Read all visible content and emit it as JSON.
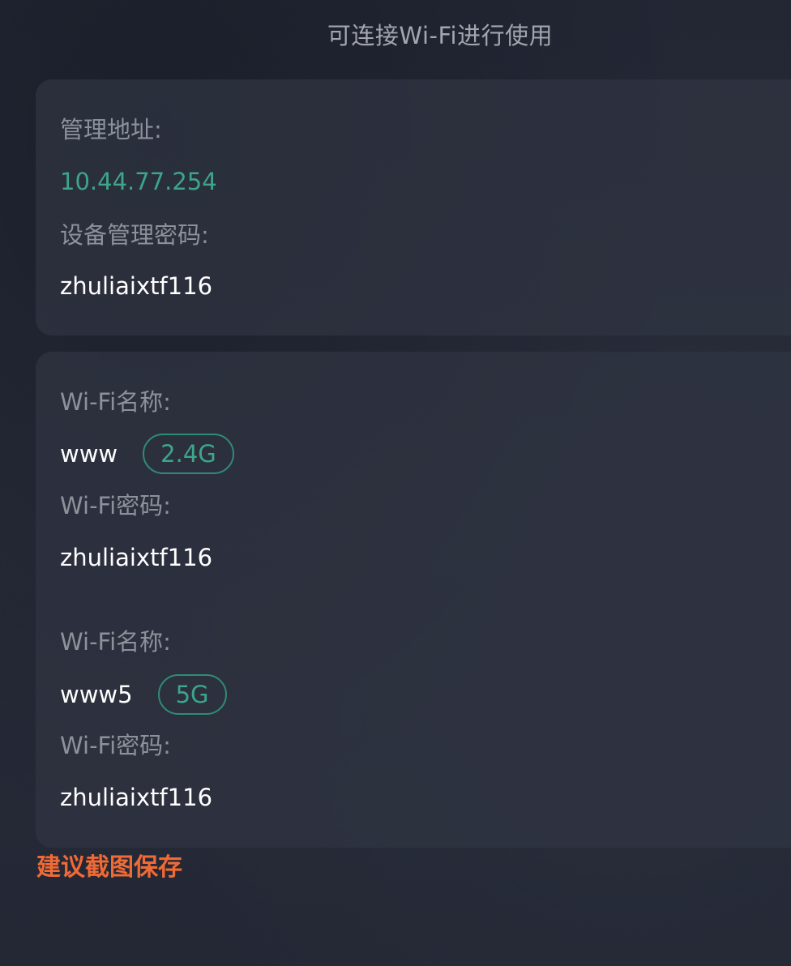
{
  "header": {
    "title": "可连接Wi-Fi进行使用"
  },
  "admin": {
    "address_label": "管理地址:",
    "address_value": "10.44.77.254",
    "password_label": "设备管理密码:",
    "password_value": "zhuliaixtf116"
  },
  "wifi": {
    "networks": [
      {
        "name_label": "Wi-Fi名称:",
        "ssid": "www",
        "band": "2.4G",
        "password_label": "Wi-Fi密码:",
        "password": "zhuliaixtf116"
      },
      {
        "name_label": "Wi-Fi名称:",
        "ssid": "www5",
        "band": "5G",
        "password_label": "Wi-Fi密码:",
        "password": "zhuliaixtf116"
      }
    ]
  },
  "footer": {
    "tip": "建议截图保存"
  },
  "colors": {
    "accent_green": "#3ca58a",
    "tip_orange": "#f06a35",
    "label_gray": "#8d919a"
  }
}
